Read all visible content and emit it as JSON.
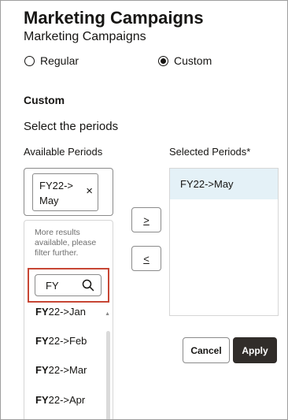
{
  "header": {
    "title": "Marketing Campaigns",
    "subtitle": "Marketing Campaigns"
  },
  "type_selector": {
    "options": [
      {
        "label": "Regular",
        "selected": false
      },
      {
        "label": "Custom",
        "selected": true
      }
    ]
  },
  "custom_section": {
    "heading": "Custom",
    "instruction": "Select the periods",
    "available_label": "Available Periods",
    "selected_label": "Selected Periods*"
  },
  "available": {
    "chip_label": "FY22->May",
    "chip_remove_glyph": "×",
    "more_results": "More results available, please filter further.",
    "search_value": "FY",
    "options": [
      {
        "match": "FY",
        "rest": "22->Jan"
      },
      {
        "match": "FY",
        "rest": "22->Feb"
      },
      {
        "match": "FY",
        "rest": "22->Mar"
      },
      {
        "match": "FY",
        "rest": "22->Apr"
      }
    ]
  },
  "move_buttons": {
    "add_glyph": ">",
    "remove_glyph": "<"
  },
  "selected": {
    "items": [
      "FY22->May"
    ]
  },
  "footer": {
    "cancel_label": "Cancel",
    "apply_label": "Apply"
  },
  "colors": {
    "focus_highlight": "#c74634",
    "selected_row_bg": "#e4f1f7",
    "apply_bg": "#312d2a"
  },
  "icons": {
    "search": "search-icon",
    "remove_chip": "close-icon",
    "radio": "radio-button-icon"
  }
}
